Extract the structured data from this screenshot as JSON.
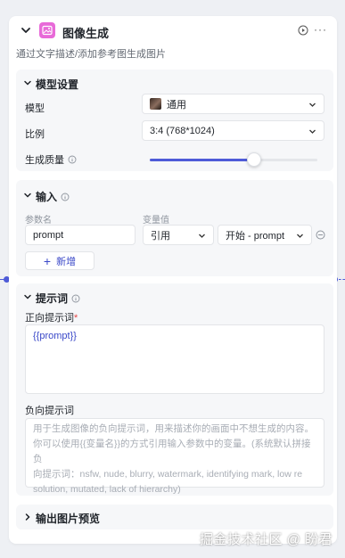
{
  "node": {
    "title": "图像生成",
    "description": "通过文字描述/添加参考图生成图片",
    "more": "···"
  },
  "model_settings": {
    "title": "模型设置",
    "model_label": "模型",
    "model_value": "通用",
    "ratio_label": "比例",
    "ratio_value": "3:4 (768*1024)",
    "quality_label": "生成质量",
    "quality_level": 0.62
  },
  "input_section": {
    "title": "输入",
    "col_name": "参数名",
    "col_value": "变量值",
    "rows": [
      {
        "name": "prompt",
        "type": "引用",
        "value": "开始 - prompt"
      }
    ],
    "add_label": "新增"
  },
  "prompt_section": {
    "title": "提示词",
    "positive_label": "正向提示词",
    "required_mark": "*",
    "positive_value": "{{prompt}}",
    "negative_label": "负向提示词",
    "negative_placeholder_lines": [
      "用于生成图像的负向提示词，用来描述你的画面中不想生成的内容。",
      "你可以使用{{变量名}}的方式引用输入参数中的变量。(系统默认拼接负",
      "向提示词：nsfw, nude, blurry, watermark, identifying mark, low re",
      "solution, mutated, lack of hierarchy)"
    ]
  },
  "output_preview": {
    "title": "输出图片预览"
  },
  "watermark": "掘金技术社区 @ 盼君",
  "colors": {
    "accent": "#4e5bd8",
    "node_icon": "#e86ad8",
    "panel_bg": "#f6f7f9"
  }
}
